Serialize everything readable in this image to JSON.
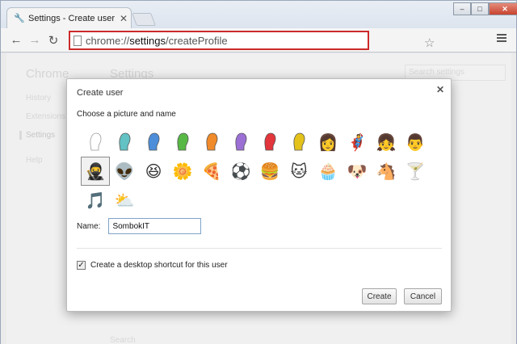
{
  "tab": {
    "title": "Settings - Create user"
  },
  "toolbar": {
    "url_scheme": "chrome://",
    "url_host": "settings",
    "url_path": "/createProfile"
  },
  "page": {
    "brand": "Chrome",
    "title": "Settings",
    "search_placeholder": "Search settings",
    "nav": [
      "History",
      "Extensions",
      "Settings",
      "Help"
    ],
    "bottom_text": "Search"
  },
  "dialog": {
    "title": "Create user",
    "subtitle": "Choose a picture and name",
    "name_label": "Name:",
    "name_value": "SombokIT",
    "checkbox_label": "Create a desktop shortcut for this user",
    "checkbox_checked": true,
    "create_label": "Create",
    "cancel_label": "Cancel",
    "avatars": [
      {
        "name": "silhouette-white",
        "color": "#ffffff"
      },
      {
        "name": "silhouette-teal",
        "color": "#62c2c4"
      },
      {
        "name": "silhouette-blue",
        "color": "#4c8ed9"
      },
      {
        "name": "silhouette-green",
        "color": "#58b845"
      },
      {
        "name": "silhouette-orange",
        "color": "#f08a2a"
      },
      {
        "name": "silhouette-purple",
        "color": "#9b6fd4"
      },
      {
        "name": "silhouette-red",
        "color": "#e2353c"
      },
      {
        "name": "silhouette-yellow",
        "color": "#e4c21a"
      },
      {
        "name": "blonde-woman",
        "emoji": "👩"
      },
      {
        "name": "superhero",
        "emoji": "🦸"
      },
      {
        "name": "hair-woman",
        "emoji": "👧"
      },
      {
        "name": "man",
        "emoji": "👨"
      },
      {
        "name": "ninja",
        "emoji": "🥷",
        "selected": true
      },
      {
        "name": "alien",
        "emoji": "👽"
      },
      {
        "name": "smiley",
        "emoji": "😆"
      },
      {
        "name": "flower",
        "emoji": "🌼"
      },
      {
        "name": "pizza",
        "emoji": "🍕"
      },
      {
        "name": "soccer-ball",
        "emoji": "⚽"
      },
      {
        "name": "burger",
        "emoji": "🍔"
      },
      {
        "name": "cat",
        "emoji": "🐱"
      },
      {
        "name": "cupcake",
        "emoji": "🧁"
      },
      {
        "name": "dog",
        "emoji": "🐶"
      },
      {
        "name": "horse",
        "emoji": "🐴"
      },
      {
        "name": "cocktail",
        "emoji": "🍸"
      },
      {
        "name": "music-note",
        "emoji": "🎵"
      },
      {
        "name": "sun-cloud",
        "emoji": "⛅"
      }
    ]
  }
}
